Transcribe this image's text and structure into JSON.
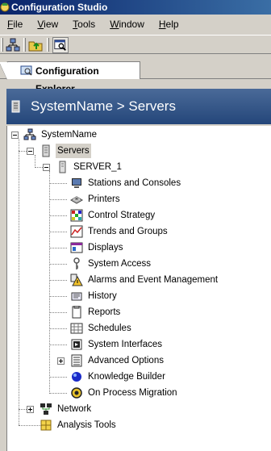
{
  "window": {
    "title": "Configuration Studio"
  },
  "menu": [
    {
      "label": "File",
      "key": "F",
      "rest": "ile"
    },
    {
      "label": "View",
      "key": "V",
      "rest": "iew"
    },
    {
      "label": "Tools",
      "key": "T",
      "rest": "ools"
    },
    {
      "label": "Window",
      "key": "W",
      "rest": "indow"
    },
    {
      "label": "Help",
      "key": "H",
      "rest": "elp"
    }
  ],
  "tab": {
    "label": "Configuration Explorer"
  },
  "header": {
    "title": "SystemName > Servers"
  },
  "tree": {
    "root": "SystemName",
    "servers": "Servers",
    "server1": "SERVER_1",
    "items": [
      "Stations and Consoles",
      "Printers",
      "Control Strategy",
      "Trends and Groups",
      "Displays",
      "System Access",
      "Alarms and Event Management",
      "History",
      "Reports",
      "Schedules",
      "System Interfaces",
      "Advanced Options",
      "Knowledge Builder",
      "On Process Migration"
    ],
    "network": "Network",
    "analysis": "Analysis Tools"
  }
}
